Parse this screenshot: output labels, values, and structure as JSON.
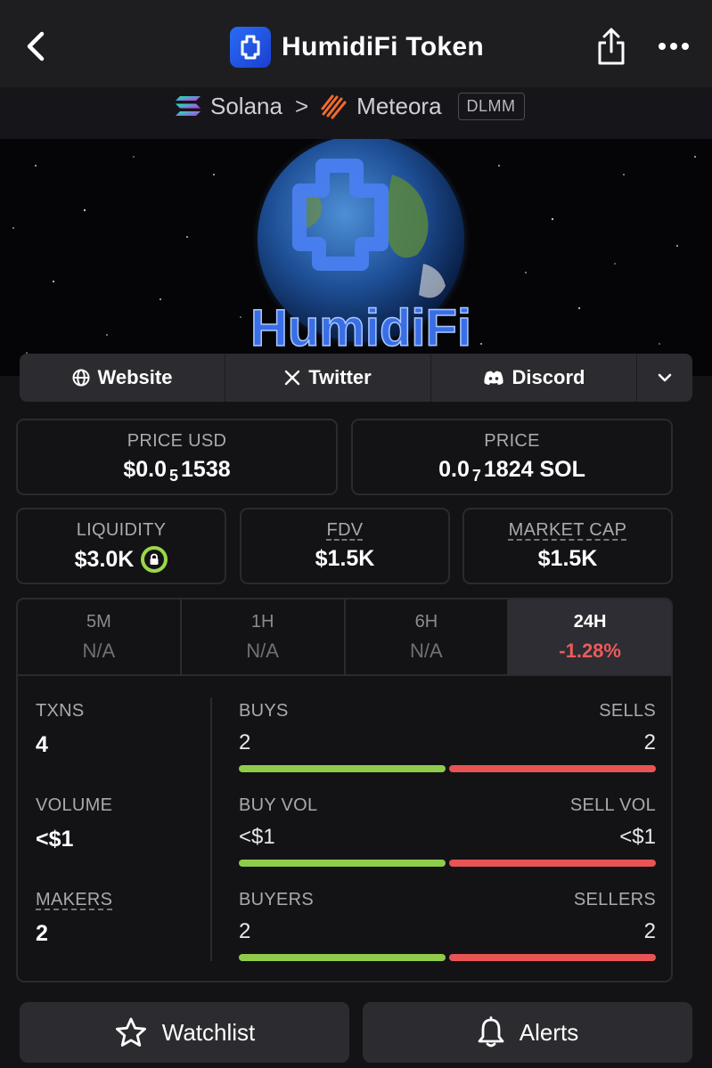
{
  "header": {
    "title": "HumidiFi Token",
    "back_icon": "chevron-left-icon",
    "share_icon": "share-icon",
    "more_icon": "more-horizontal-icon"
  },
  "breadcrumb": {
    "chain": "Solana",
    "separator": ">",
    "dex": "Meteora",
    "pool_type": "DLMM"
  },
  "banner": {
    "text": "HumidiFi"
  },
  "social": {
    "website": "Website",
    "twitter": "Twitter",
    "discord": "Discord",
    "expand_icon": "chevron-down-icon"
  },
  "prices": {
    "usd_label": "PRICE USD",
    "usd_prefix": "$0.0",
    "usd_zeros": "5",
    "usd_suffix": "1538",
    "native_label": "PRICE",
    "native_prefix": "0.0",
    "native_zeros": "7",
    "native_suffix": "1824 SOL"
  },
  "metrics": {
    "liquidity_label": "LIQUIDITY",
    "liquidity_value": "$3.0K",
    "fdv_label": "FDV",
    "fdv_value": "$1.5K",
    "mcap_label": "MARKET CAP",
    "mcap_value": "$1.5K"
  },
  "tabs": [
    {
      "name": "5M",
      "value": "N/A",
      "active": false
    },
    {
      "name": "1H",
      "value": "N/A",
      "active": false
    },
    {
      "name": "6H",
      "value": "N/A",
      "active": false
    },
    {
      "name": "24H",
      "value": "-1.28%",
      "active": true
    }
  ],
  "stats": {
    "txns_label": "TXNS",
    "txns_value": "4",
    "buys_label": "BUYS",
    "buys_value": "2",
    "sells_label": "SELLS",
    "sells_value": "2",
    "volume_label": "VOLUME",
    "volume_value": "<$1",
    "buy_vol_label": "BUY VOL",
    "buy_vol_value": "<$1",
    "sell_vol_label": "SELL VOL",
    "sell_vol_value": "<$1",
    "makers_label": "MAKERS",
    "makers_value": "2",
    "buyers_label": "BUYERS",
    "buyers_value": "2",
    "sellers_label": "SELLERS",
    "sellers_value": "2",
    "buy_share": 0.5
  },
  "colors": {
    "buy": "#8fcb4a",
    "sell": "#e85454",
    "negative": "#ee5a5a",
    "accent": "#2a6cf5"
  },
  "actions": {
    "watchlist": "Watchlist",
    "alerts": "Alerts"
  }
}
